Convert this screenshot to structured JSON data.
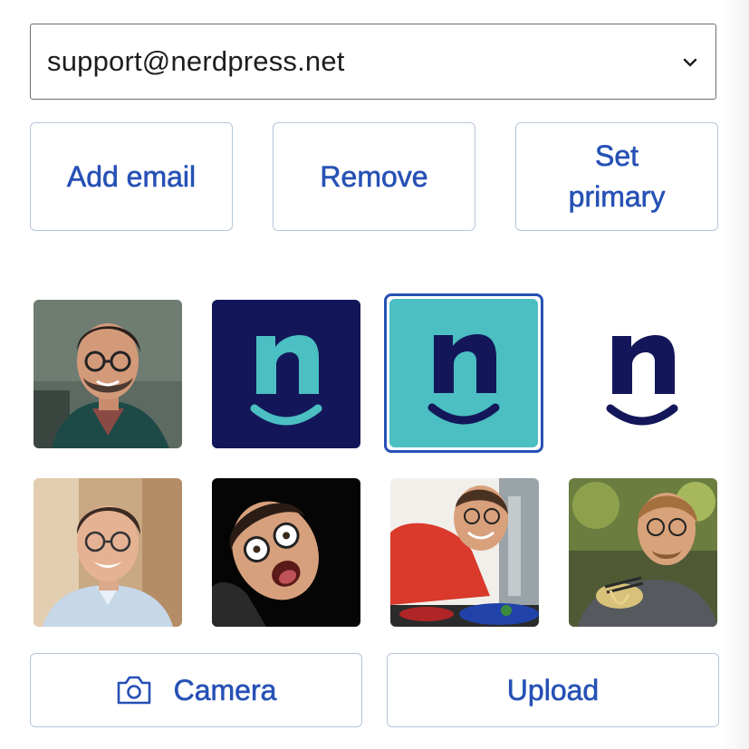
{
  "email_select": {
    "selected": "support@nerdpress.net"
  },
  "actions": {
    "add_email": "Add email",
    "remove": "Remove",
    "set_primary": "Set primary"
  },
  "avatars": [
    {
      "id": "photo-glasses-teal-jacket",
      "selected": false
    },
    {
      "id": "logo-n-navy-bg",
      "selected": false
    },
    {
      "id": "logo-n-teal-bg",
      "selected": true
    },
    {
      "id": "logo-n-white-bg",
      "selected": false
    },
    {
      "id": "photo-smiling-light-shirt",
      "selected": false
    },
    {
      "id": "photo-funny-face-black-bg",
      "selected": false
    },
    {
      "id": "photo-red-shirt-kitchen",
      "selected": false
    },
    {
      "id": "photo-eating-noodles",
      "selected": false
    }
  ],
  "bottom_actions": {
    "camera": "Camera",
    "upload": "Upload"
  },
  "colors": {
    "accent": "#2651b5",
    "navy": "#13175a",
    "teal": "#4bbfc2",
    "border": "#b7c5dc"
  },
  "icons": {
    "dropdown": "chevron-down-icon",
    "camera": "camera-icon"
  }
}
